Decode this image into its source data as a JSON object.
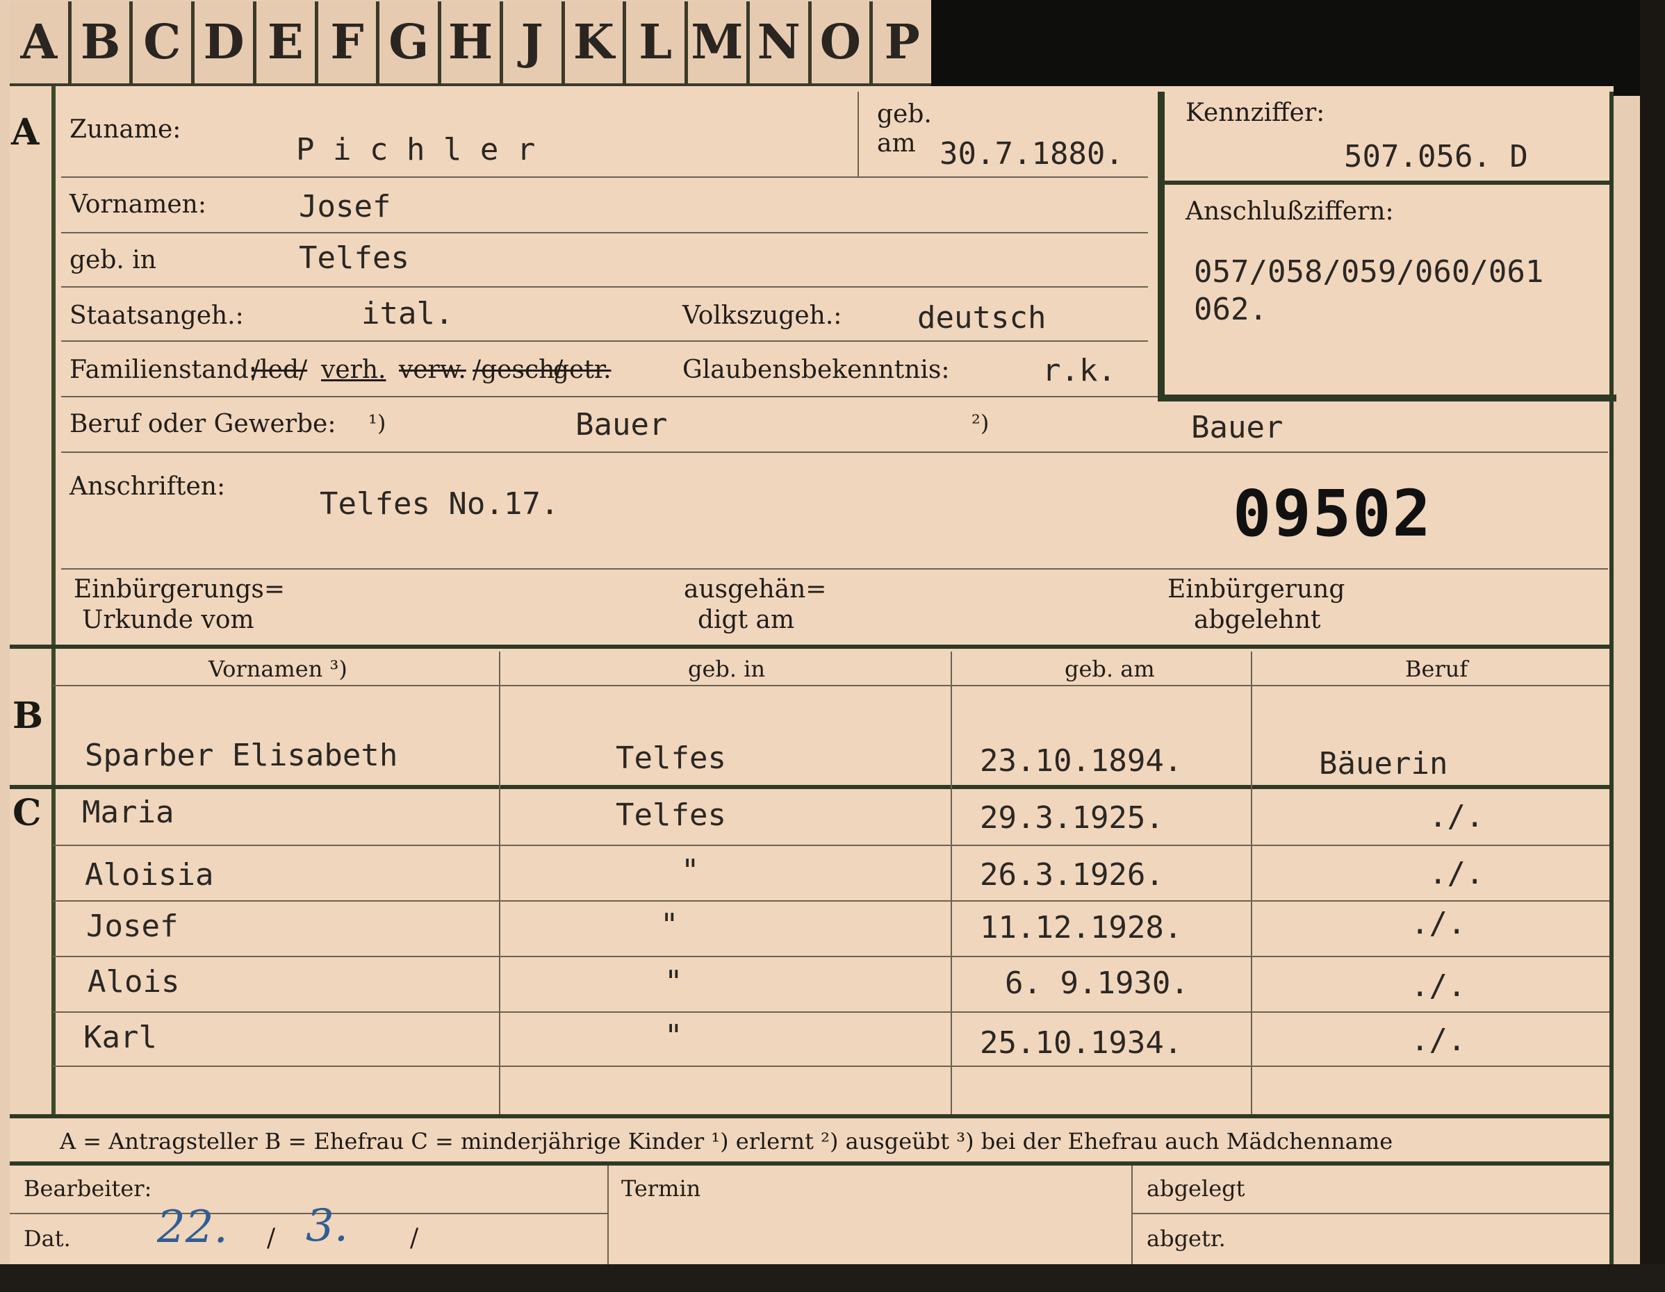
{
  "tabs": [
    "A",
    "B",
    "C",
    "D",
    "E",
    "F",
    "G",
    "H",
    "J",
    "K",
    "L",
    "M",
    "N",
    "O",
    "P"
  ],
  "section_letters": {
    "a": "A",
    "b": "B",
    "c": "C"
  },
  "header": {
    "surname_label": "Zuname:",
    "surname_value": "P i c h l e r",
    "geb_label": "geb.",
    "am_label": "am",
    "birth_date": "30.7.1880.",
    "kennziffer_label": "Kennziffer:",
    "kennziffer_value": "507.056.  D",
    "anschluss_label": "Anschlußziffern:",
    "anschluss_line1": "057/058/059/060/061",
    "anschluss_line2": "062.",
    "vornamen_label": "Vornamen:",
    "vornamen_value": "Josef",
    "gebin_label": "geb. in",
    "gebin_value": "Telfes",
    "staats_label": "Staatsangeh.:",
    "staats_value": "ital.",
    "volks_label": "Volkszugeh.:",
    "volks_value": "deutsch",
    "familienstand_label": "Familienstand:",
    "fam_opt_led": "/led/",
    "fam_opt_verh": "verh.",
    "fam_opt_verw": "verw.",
    "fam_opt_gesch": "/gesch/",
    "fam_opt_getr": "getr.",
    "glauben_label": "Glaubensbekenntnis:",
    "glauben_value": "r.k.",
    "beruf_label": "Beruf oder Gewerbe:",
    "beruf_fn1": "¹)",
    "beruf_value1": "Bauer",
    "beruf_fn2": "²)",
    "beruf_value2": "Bauer",
    "anschriften_label": "Anschriften:",
    "anschriften_value": "Telfes No.17.",
    "stamp_number": "09502",
    "einb_label_1": "Einbürgerungs=",
    "einb_label_2": "Urkunde vom",
    "ausg_label_1": "ausgehän=",
    "ausg_label_2": "digt am",
    "abgel_label_1": "Einbürgerung",
    "abgel_label_2": "abgelehnt"
  },
  "table": {
    "columns": [
      "Vornamen ³)",
      "geb. in",
      "geb. am",
      "Beruf"
    ],
    "spouse": {
      "name": "Sparber Elisabeth",
      "place": "Telfes",
      "date": "23.10.1894.",
      "job": "Bäuerin"
    },
    "children": [
      {
        "name": "Maria",
        "place": "Telfes",
        "date": "29.3.1925.",
        "job": "./."
      },
      {
        "name": "Aloisia",
        "place": "\"",
        "date": "26.3.1926.",
        "job": "./."
      },
      {
        "name": "Josef",
        "place": "\"",
        "date": "11.12.1928.",
        "job": "./."
      },
      {
        "name": "Alois",
        "place": "\"",
        "date": "6. 9.1930.",
        "job": "./."
      },
      {
        "name": "Karl",
        "place": "\"",
        "date": "25.10.1934.",
        "job": "./."
      }
    ]
  },
  "legend": "A = Antragsteller    B = Ehefrau    C = minderjährige Kinder    ¹) erlernt    ²) ausgeübt    ³) bei der Ehefrau auch Mädchenname",
  "footer": {
    "bearbeiter_label": "Bearbeiter:",
    "dat_label": "Dat.",
    "dat_day": "22.",
    "dat_sep1": "/",
    "dat_month": "3.",
    "dat_sep2": "/",
    "termin_label": "Termin",
    "abgelegt_label": "abgelegt",
    "abgetr_label": "abgetr."
  }
}
